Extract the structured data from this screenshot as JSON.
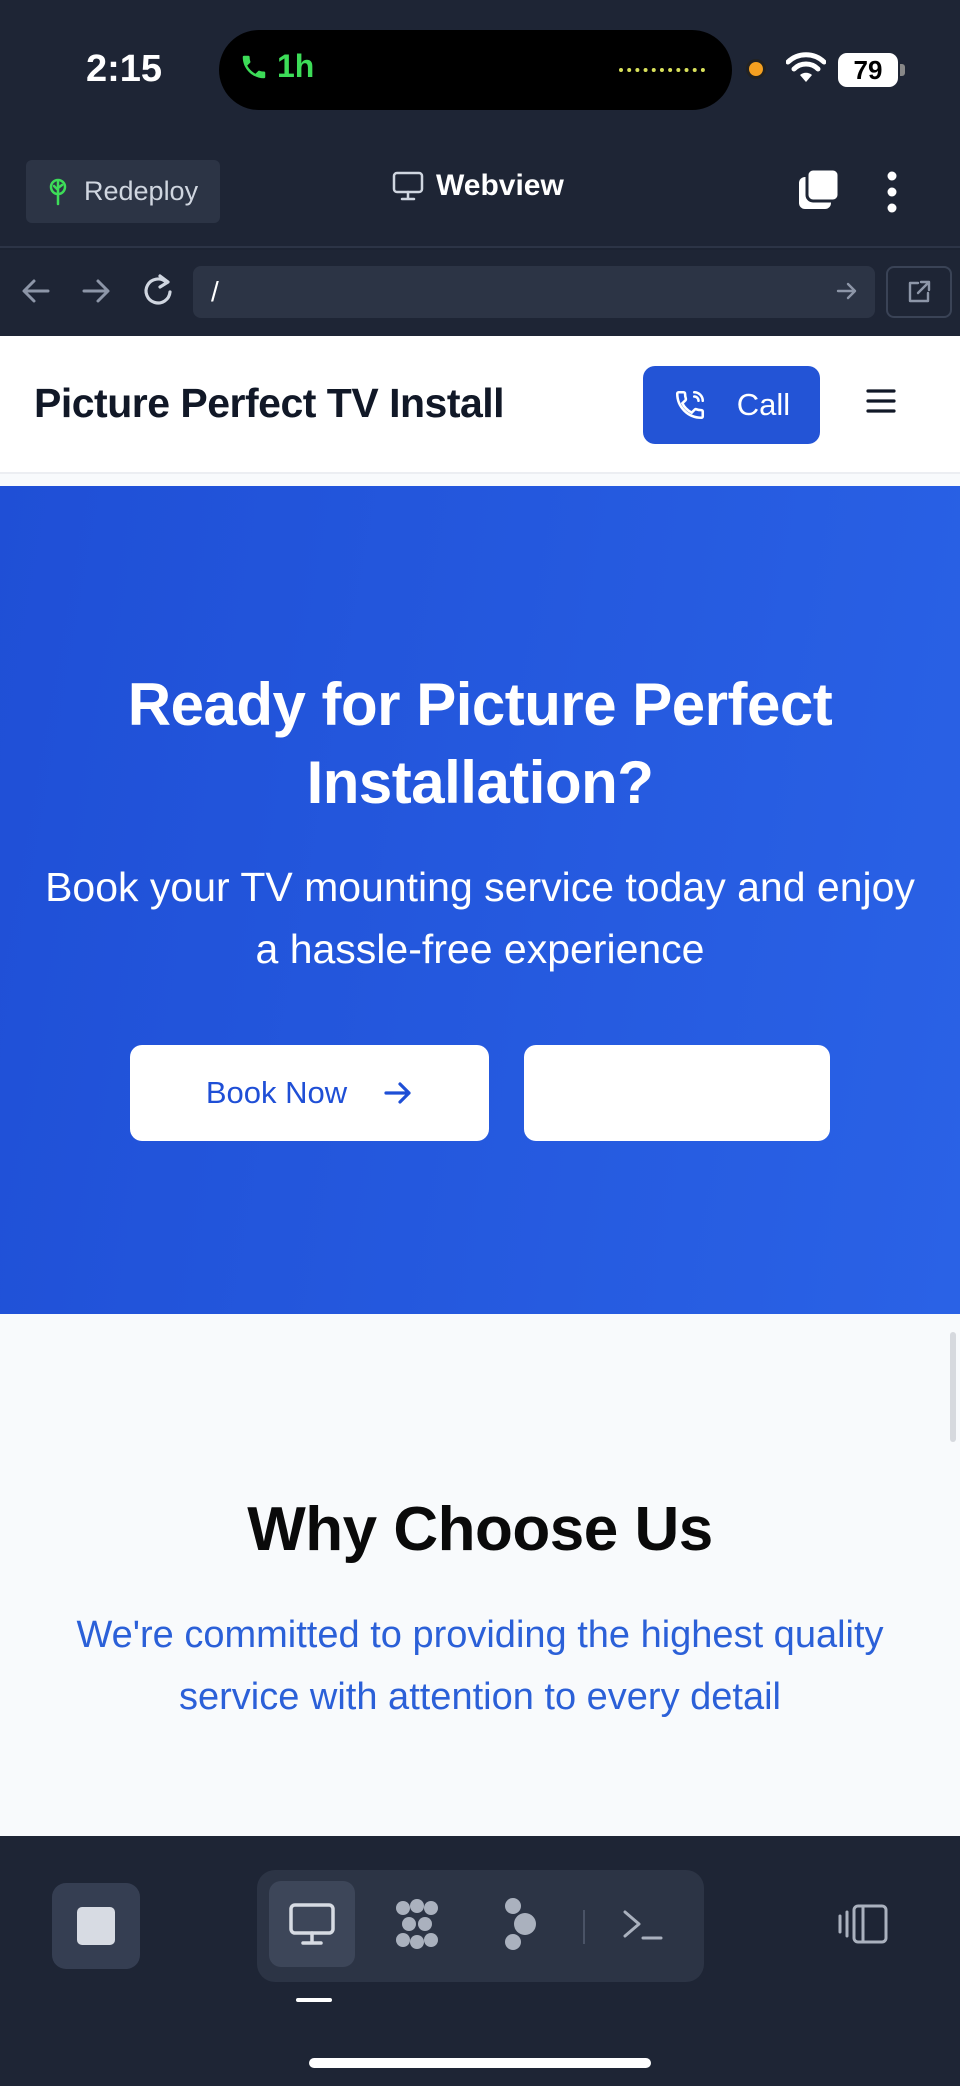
{
  "status_bar": {
    "time": "2:15",
    "call_duration": "1h",
    "battery": "79"
  },
  "toolbar": {
    "redeploy_label": "Redeploy",
    "webview_label": "Webview"
  },
  "url_bar": {
    "value": "/"
  },
  "site": {
    "title": "Picture Perfect TV Install",
    "call_label": "Call",
    "hero": {
      "title": "Ready for Picture Perfect Installation?",
      "subtitle": "Book your TV mounting service today and enjoy a hassle-free experience",
      "book_label": "Book Now",
      "second_label": ""
    },
    "why": {
      "title": "Why Choose Us",
      "subtitle": "We're committed to providing the highest quality service with attention to every detail"
    }
  },
  "colors": {
    "app_bg": "#1e2535",
    "hero_blue": "#2354d6",
    "accent_text": "#2b60d8",
    "call_green": "#3ddc58"
  },
  "icons": {
    "redeploy": "sprout-icon",
    "webview": "monitor-icon",
    "tabs": "tabs-icon",
    "menu": "kebab-menu-icon",
    "back": "arrow-left-icon",
    "forward": "arrow-right-icon",
    "reload": "reload-icon",
    "go": "arrow-right-icon",
    "open_external": "external-link-icon",
    "call": "phone-icon",
    "hamburger": "hamburger-icon",
    "book_arrow": "arrow-right-icon",
    "stop": "stop-icon",
    "preview": "monitor-icon",
    "components": "grid-dots-icon",
    "agent": "agent-icon",
    "shell": "terminal-icon",
    "panel": "panel-toggle-icon"
  }
}
